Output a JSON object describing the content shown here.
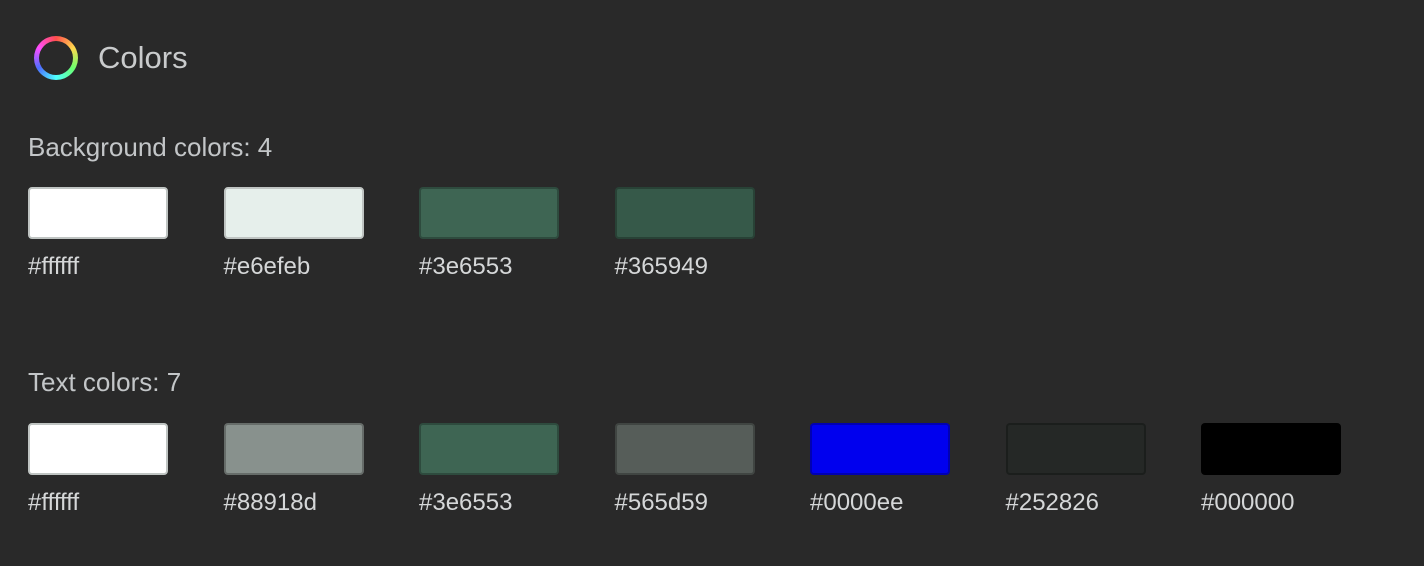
{
  "header": {
    "title": "Colors",
    "icon": "color-wheel-icon"
  },
  "background": {
    "label": "Background colors: 4",
    "swatches": [
      {
        "hex": "#ffffff",
        "label": "#ffffff",
        "light": true
      },
      {
        "hex": "#e6efeb",
        "label": "#e6efeb",
        "light": true
      },
      {
        "hex": "#3e6553",
        "label": "#3e6553",
        "light": false
      },
      {
        "hex": "#365949",
        "label": "#365949",
        "light": false
      }
    ]
  },
  "text": {
    "label": "Text colors: 7",
    "swatches": [
      {
        "hex": "#ffffff",
        "label": "#ffffff",
        "light": true
      },
      {
        "hex": "#88918d",
        "label": "#88918d",
        "light": false
      },
      {
        "hex": "#3e6553",
        "label": "#3e6553",
        "light": false
      },
      {
        "hex": "#565d59",
        "label": "#565d59",
        "light": false
      },
      {
        "hex": "#0000ee",
        "label": "#0000ee",
        "light": false
      },
      {
        "hex": "#252826",
        "label": "#252826",
        "light": false
      },
      {
        "hex": "#000000",
        "label": "#000000",
        "light": false
      }
    ]
  },
  "colors": {
    "page_background": "#292929",
    "label_text": "#c3c6c8"
  }
}
